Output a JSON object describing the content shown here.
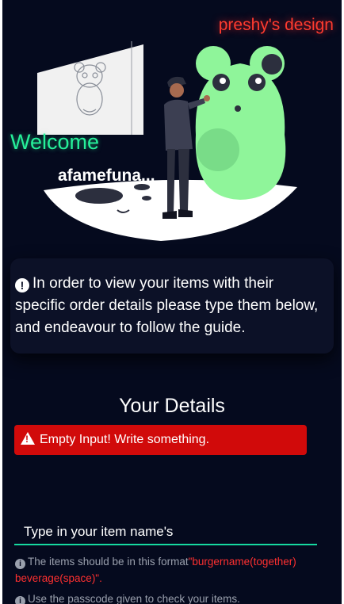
{
  "brand": {
    "text": "preshy's design"
  },
  "hero": {
    "welcome": "Welcome",
    "username": "afamefuna..."
  },
  "notice": {
    "icon": "info-circle-icon",
    "text": "In order to view your items with their specific order details please type them below, and endeavour to follow the guide."
  },
  "details": {
    "title": "Your Details",
    "alert_icon": "warning-triangle-icon",
    "alert_text": "Empty Input! Write something.",
    "input_placeholder": "Type in your item name's",
    "input_value": ""
  },
  "guides": [
    {
      "icon": "info-icon",
      "lead": "The items should be in this format",
      "format": "\"burgername(together) beverage(space)\"."
    },
    {
      "icon": "info-icon",
      "text": "Use the passcode given to check your items."
    }
  ],
  "colors": {
    "background": "#050a1e",
    "brand": "#ff3b2f",
    "welcome": "#26f09a",
    "alert": "#d10a0a",
    "input_underline": "#16d9a0",
    "format_text": "#ff3030"
  }
}
